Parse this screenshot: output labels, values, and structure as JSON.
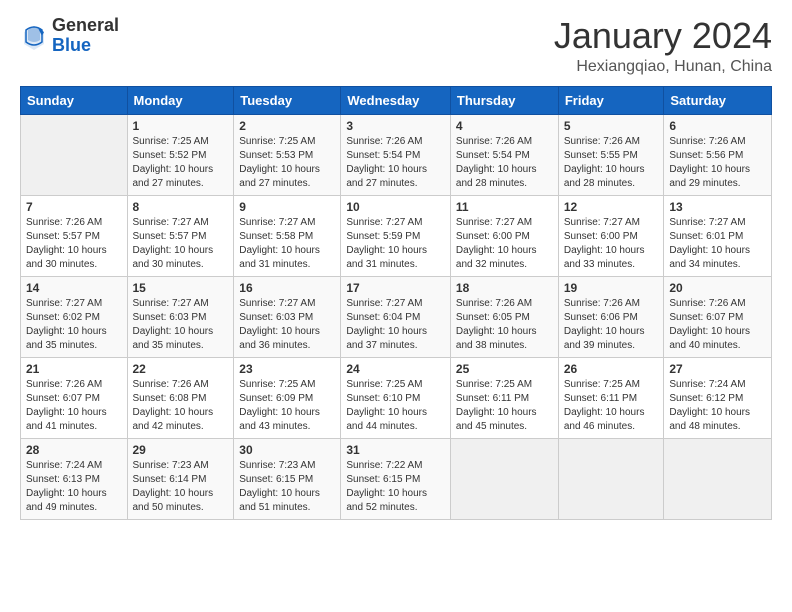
{
  "header": {
    "logo_general": "General",
    "logo_blue": "Blue",
    "month_year": "January 2024",
    "location": "Hexiangqiao, Hunan, China"
  },
  "weekdays": [
    "Sunday",
    "Monday",
    "Tuesday",
    "Wednesday",
    "Thursday",
    "Friday",
    "Saturday"
  ],
  "weeks": [
    [
      {
        "day": "",
        "info": ""
      },
      {
        "day": "1",
        "info": "Sunrise: 7:25 AM\nSunset: 5:52 PM\nDaylight: 10 hours\nand 27 minutes."
      },
      {
        "day": "2",
        "info": "Sunrise: 7:25 AM\nSunset: 5:53 PM\nDaylight: 10 hours\nand 27 minutes."
      },
      {
        "day": "3",
        "info": "Sunrise: 7:26 AM\nSunset: 5:54 PM\nDaylight: 10 hours\nand 27 minutes."
      },
      {
        "day": "4",
        "info": "Sunrise: 7:26 AM\nSunset: 5:54 PM\nDaylight: 10 hours\nand 28 minutes."
      },
      {
        "day": "5",
        "info": "Sunrise: 7:26 AM\nSunset: 5:55 PM\nDaylight: 10 hours\nand 28 minutes."
      },
      {
        "day": "6",
        "info": "Sunrise: 7:26 AM\nSunset: 5:56 PM\nDaylight: 10 hours\nand 29 minutes."
      }
    ],
    [
      {
        "day": "7",
        "info": "Sunrise: 7:26 AM\nSunset: 5:57 PM\nDaylight: 10 hours\nand 30 minutes."
      },
      {
        "day": "8",
        "info": "Sunrise: 7:27 AM\nSunset: 5:57 PM\nDaylight: 10 hours\nand 30 minutes."
      },
      {
        "day": "9",
        "info": "Sunrise: 7:27 AM\nSunset: 5:58 PM\nDaylight: 10 hours\nand 31 minutes."
      },
      {
        "day": "10",
        "info": "Sunrise: 7:27 AM\nSunset: 5:59 PM\nDaylight: 10 hours\nand 31 minutes."
      },
      {
        "day": "11",
        "info": "Sunrise: 7:27 AM\nSunset: 6:00 PM\nDaylight: 10 hours\nand 32 minutes."
      },
      {
        "day": "12",
        "info": "Sunrise: 7:27 AM\nSunset: 6:00 PM\nDaylight: 10 hours\nand 33 minutes."
      },
      {
        "day": "13",
        "info": "Sunrise: 7:27 AM\nSunset: 6:01 PM\nDaylight: 10 hours\nand 34 minutes."
      }
    ],
    [
      {
        "day": "14",
        "info": "Sunrise: 7:27 AM\nSunset: 6:02 PM\nDaylight: 10 hours\nand 35 minutes."
      },
      {
        "day": "15",
        "info": "Sunrise: 7:27 AM\nSunset: 6:03 PM\nDaylight: 10 hours\nand 35 minutes."
      },
      {
        "day": "16",
        "info": "Sunrise: 7:27 AM\nSunset: 6:03 PM\nDaylight: 10 hours\nand 36 minutes."
      },
      {
        "day": "17",
        "info": "Sunrise: 7:27 AM\nSunset: 6:04 PM\nDaylight: 10 hours\nand 37 minutes."
      },
      {
        "day": "18",
        "info": "Sunrise: 7:26 AM\nSunset: 6:05 PM\nDaylight: 10 hours\nand 38 minutes."
      },
      {
        "day": "19",
        "info": "Sunrise: 7:26 AM\nSunset: 6:06 PM\nDaylight: 10 hours\nand 39 minutes."
      },
      {
        "day": "20",
        "info": "Sunrise: 7:26 AM\nSunset: 6:07 PM\nDaylight: 10 hours\nand 40 minutes."
      }
    ],
    [
      {
        "day": "21",
        "info": "Sunrise: 7:26 AM\nSunset: 6:07 PM\nDaylight: 10 hours\nand 41 minutes."
      },
      {
        "day": "22",
        "info": "Sunrise: 7:26 AM\nSunset: 6:08 PM\nDaylight: 10 hours\nand 42 minutes."
      },
      {
        "day": "23",
        "info": "Sunrise: 7:25 AM\nSunset: 6:09 PM\nDaylight: 10 hours\nand 43 minutes."
      },
      {
        "day": "24",
        "info": "Sunrise: 7:25 AM\nSunset: 6:10 PM\nDaylight: 10 hours\nand 44 minutes."
      },
      {
        "day": "25",
        "info": "Sunrise: 7:25 AM\nSunset: 6:11 PM\nDaylight: 10 hours\nand 45 minutes."
      },
      {
        "day": "26",
        "info": "Sunrise: 7:25 AM\nSunset: 6:11 PM\nDaylight: 10 hours\nand 46 minutes."
      },
      {
        "day": "27",
        "info": "Sunrise: 7:24 AM\nSunset: 6:12 PM\nDaylight: 10 hours\nand 48 minutes."
      }
    ],
    [
      {
        "day": "28",
        "info": "Sunrise: 7:24 AM\nSunset: 6:13 PM\nDaylight: 10 hours\nand 49 minutes."
      },
      {
        "day": "29",
        "info": "Sunrise: 7:23 AM\nSunset: 6:14 PM\nDaylight: 10 hours\nand 50 minutes."
      },
      {
        "day": "30",
        "info": "Sunrise: 7:23 AM\nSunset: 6:15 PM\nDaylight: 10 hours\nand 51 minutes."
      },
      {
        "day": "31",
        "info": "Sunrise: 7:22 AM\nSunset: 6:15 PM\nDaylight: 10 hours\nand 52 minutes."
      },
      {
        "day": "",
        "info": ""
      },
      {
        "day": "",
        "info": ""
      },
      {
        "day": "",
        "info": ""
      }
    ]
  ]
}
